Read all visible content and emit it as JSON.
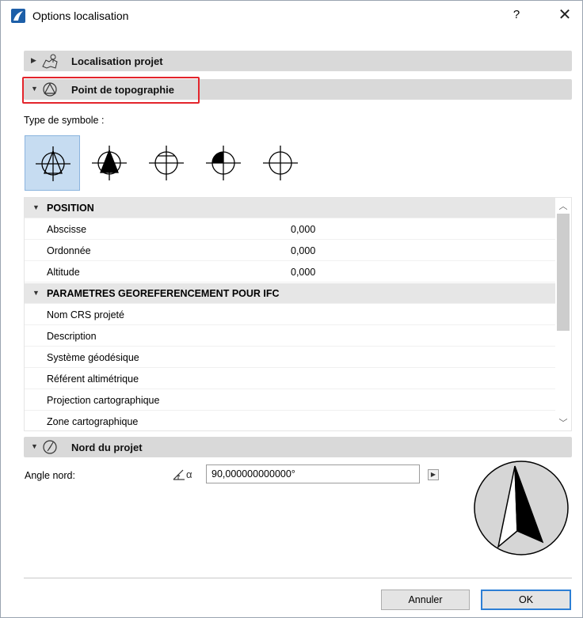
{
  "window": {
    "title": "Options localisation",
    "help_label": "?",
    "close_label": "✕"
  },
  "sections": {
    "localisation": {
      "label": "Localisation projet",
      "expanded": false
    },
    "topographie": {
      "label": "Point de topographie",
      "expanded": true
    },
    "nord": {
      "label": "Nord du projet",
      "expanded": true
    }
  },
  "symbol_type": {
    "label": "Type de symbole :",
    "selected_index": 0,
    "icons": [
      "symbol-1-icon",
      "symbol-2-icon",
      "symbol-3-icon",
      "symbol-4-icon",
      "symbol-5-icon"
    ]
  },
  "table": {
    "groups": [
      {
        "label": "POSITION",
        "rows": [
          {
            "name": "Abscisse",
            "value": "0,000"
          },
          {
            "name": "Ordonnée",
            "value": "0,000"
          },
          {
            "name": "Altitude",
            "value": "0,000"
          }
        ]
      },
      {
        "label": "PARAMETRES GEOREFERENCEMENT POUR IFC",
        "rows": [
          {
            "name": "Nom CRS projeté",
            "value": ""
          },
          {
            "name": "Description",
            "value": ""
          },
          {
            "name": "Système géodésique",
            "value": ""
          },
          {
            "name": "Référent altimétrique",
            "value": ""
          },
          {
            "name": "Projection cartographique",
            "value": ""
          },
          {
            "name": "Zone cartographique",
            "value": ""
          }
        ]
      }
    ]
  },
  "north": {
    "angle_label": "Angle nord:",
    "angle_icon_text": "α",
    "angle_value": "90,000000000000°"
  },
  "buttons": {
    "cancel": "Annuler",
    "ok": "OK"
  },
  "colors": {
    "accent": "#2d7fd5",
    "highlight": "#e3242b",
    "selected_bg": "#c6dcf1"
  }
}
